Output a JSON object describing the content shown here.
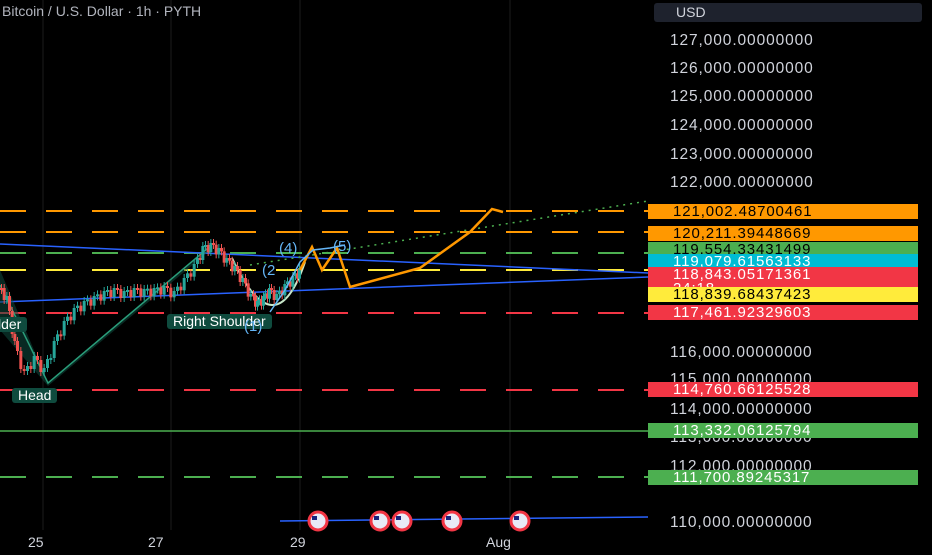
{
  "header": {
    "title": "Bitcoin / U.S. Dollar · 1h · PYTH"
  },
  "currency_button": "USD",
  "price_ticks": [
    "127,000.00000000",
    "126,000.00000000",
    "125,000.00000000",
    "124,000.00000000",
    "123,000.00000000",
    "122,000.00000000",
    "116,000.00000000",
    "115,000.00000000",
    "114,000.00000000",
    "113,000.00000000",
    "112,000.00000000",
    "110,000.00000000"
  ],
  "price_tags": [
    {
      "value": "121,002.48700461",
      "color": "#ff9800"
    },
    {
      "value": "120,211.39448669",
      "color": "#ff9800"
    },
    {
      "value": "119,554.33431499",
      "color": "#4caf50"
    },
    {
      "value": "119,079.61563133",
      "color": "#00bcd4"
    },
    {
      "value": "118,843.05171361",
      "color": "#f23645",
      "countdown": "24:18"
    },
    {
      "value": "118,839.68437423",
      "color": "#ffeb3b"
    },
    {
      "value": "117,461.92329603",
      "color": "#f23645"
    },
    {
      "value": "114,760.66125528",
      "color": "#f23645"
    },
    {
      "value": "113,332.06125794",
      "color": "#4caf50"
    },
    {
      "value": "111,700.89245317",
      "color": "#4caf50"
    }
  ],
  "x_axis_labels": [
    "25",
    "27",
    "29",
    "Aug"
  ],
  "annotations": {
    "left_shoulder": "lder",
    "head": "Head",
    "right_shoulder": "Right Shoulder",
    "wave_4": "(4)",
    "wave_5": "(5)",
    "wave_2": "(2",
    "wave_1": "(1)"
  },
  "colors": {
    "orange": "#ff9800",
    "green": "#4caf50",
    "red": "#f23645",
    "cyan": "#00bcd4",
    "yellow": "#ffeb3b",
    "blue_trend": "#2962ff",
    "pattern_fill": "#0f4b3e"
  }
}
